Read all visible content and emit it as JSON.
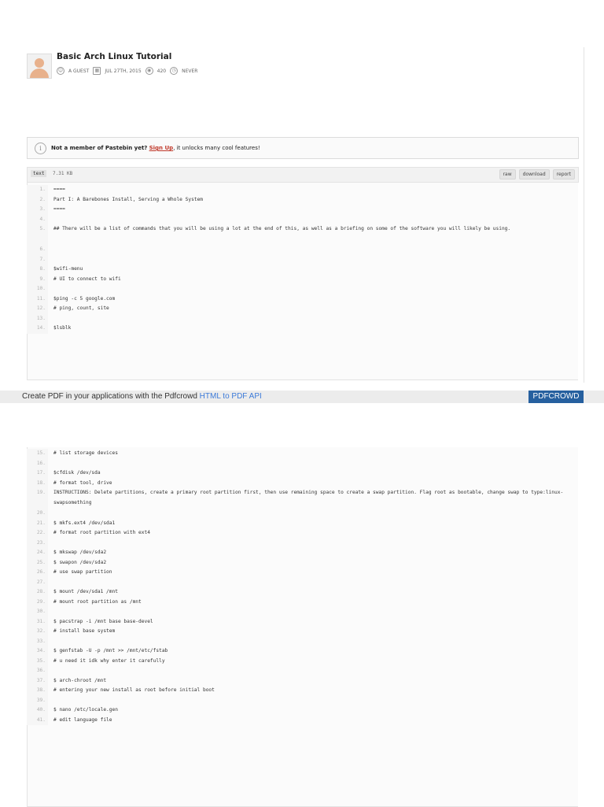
{
  "paste": {
    "title": "Basic Arch Linux Tutorial",
    "author": "A GUEST",
    "date": "JUL 27TH, 2015",
    "views": "420",
    "expires": "NEVER"
  },
  "notice": {
    "prefix": "Not a member of Pastebin yet?",
    "link": "Sign Up",
    "suffix": ", it unlocks many cool features!"
  },
  "toolbar": {
    "format": "text",
    "size": "7.31 KB",
    "raw": "raw",
    "download": "download",
    "report": "report"
  },
  "page1_lines": [
    {
      "n": "1.",
      "t": "===="
    },
    {
      "n": "2.",
      "t": "Part I: A Barebones Install, Serving a Whole System"
    },
    {
      "n": "3.",
      "t": "===="
    },
    {
      "n": "4.",
      "t": ""
    },
    {
      "n": "5.",
      "t": "## There will be a list of commands that you will be using a lot at the end of this, as well as a briefing on some of the software you will likely be using."
    },
    {
      "n": "6.",
      "t": ""
    },
    {
      "n": "7.",
      "t": ""
    },
    {
      "n": "8.",
      "t": "$wifi-menu"
    },
    {
      "n": "9.",
      "t": "# UI to connect to wifi"
    },
    {
      "n": "10.",
      "t": ""
    },
    {
      "n": "11.",
      "t": "$ping -c 5 google.com"
    },
    {
      "n": "12.",
      "t": "# ping, count, site"
    },
    {
      "n": "13.",
      "t": ""
    },
    {
      "n": "14.",
      "t": "$lsblk"
    }
  ],
  "page2_lines": [
    {
      "n": "15.",
      "t": "# list storage devices"
    },
    {
      "n": "16.",
      "t": ""
    },
    {
      "n": "17.",
      "t": "$cfdisk /dev/sda"
    },
    {
      "n": "18.",
      "t": "# format tool, drive"
    },
    {
      "n": "19.",
      "t": "INSTRUCTIONS: Delete partitions, create a primary root partition first, then use remaining space to create a swap partition. Flag root as bootable, change swap to type:linux-swapsomething"
    },
    {
      "n": "20.",
      "t": ""
    },
    {
      "n": "21.",
      "t": "$ mkfs.ext4 /dev/sda1"
    },
    {
      "n": "22.",
      "t": "# format root partition with ext4"
    },
    {
      "n": "23.",
      "t": ""
    },
    {
      "n": "24.",
      "t": "$ mkswap /dev/sda2"
    },
    {
      "n": "25.",
      "t": "$ swapon /dev/sda2"
    },
    {
      "n": "26.",
      "t": "# use swap partition"
    },
    {
      "n": "27.",
      "t": ""
    },
    {
      "n": "28.",
      "t": "$ mount /dev/sda1 /mnt"
    },
    {
      "n": "29.",
      "t": "# mount root partition as /mnt"
    },
    {
      "n": "30.",
      "t": ""
    },
    {
      "n": "31.",
      "t": "$ pacstrap -i /mnt base base-devel"
    },
    {
      "n": "32.",
      "t": "# install base system"
    },
    {
      "n": "33.",
      "t": ""
    },
    {
      "n": "34.",
      "t": "$ genfstab -U -p /mnt >> /mnt/etc/fstab"
    },
    {
      "n": "35.",
      "t": "# u need it idk why enter it carefully"
    },
    {
      "n": "36.",
      "t": ""
    },
    {
      "n": "37.",
      "t": "$ arch-chroot /mnt"
    },
    {
      "n": "38.",
      "t": "# entering your new install as root before initial boot"
    },
    {
      "n": "39.",
      "t": ""
    },
    {
      "n": "40.",
      "t": "$ nano /etc/locale.gen"
    },
    {
      "n": "41.",
      "t": "# edit language file"
    }
  ],
  "pdfcrowd": {
    "text": "Create PDF in your applications with the Pdfcrowd ",
    "link": "HTML to PDF API",
    "brand": "PDFCROWD"
  },
  "colors": {
    "accent_link": "#c0392b",
    "pdf_brand_bg": "#26609f",
    "pdf_link": "#3d7bd9"
  }
}
